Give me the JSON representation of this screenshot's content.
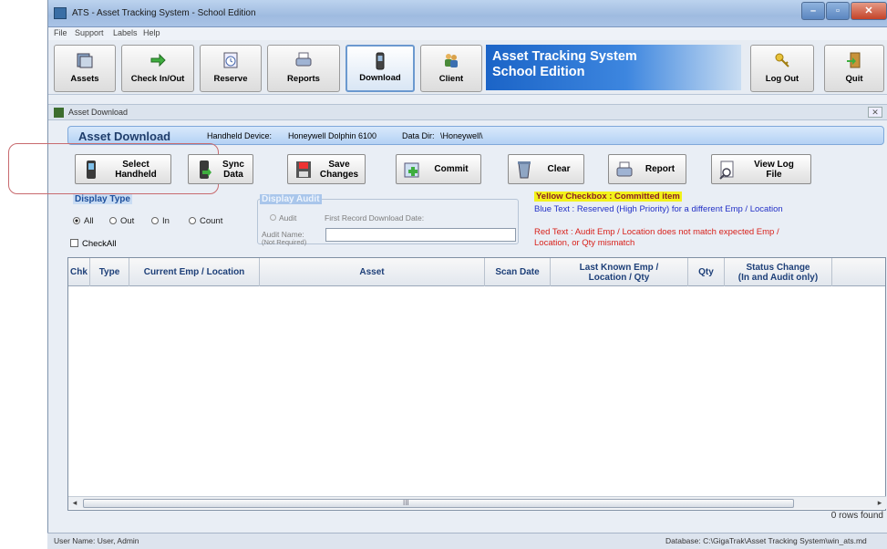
{
  "window": {
    "title": "ATS - Asset Tracking System - School Edition"
  },
  "menu": [
    "File",
    "Support",
    "Labels",
    "Help"
  ],
  "toolbar": {
    "buttons": [
      "Assets",
      "Check In/Out",
      "Reserve",
      "Reports",
      "Download",
      "Client"
    ],
    "banner_line1": "Asset Tracking System",
    "banner_line2": "School Edition",
    "logout": "Log Out",
    "quit": "Quit"
  },
  "child_window": {
    "title": "Asset Download"
  },
  "header": {
    "title": "Asset Download",
    "device_label": "Handheld Device:",
    "device": "Honeywell Dolphin 6100",
    "dir_label": "Data Dir:",
    "dir": "\\Honeywell\\"
  },
  "actions": [
    "Select\nHandheld",
    "Sync\nData",
    "Save\nChanges",
    "Commit",
    "Clear",
    "Report",
    "View Log\nFile"
  ],
  "display_type": {
    "label": "Display Type",
    "options": [
      "All",
      "Out",
      "In",
      "Count"
    ],
    "selected": "All",
    "check_all": "CheckAll"
  },
  "display_audit": {
    "label": "Display Audit",
    "audit_radio": "Audit",
    "first_record": "First Record Download Date:",
    "audit_name": "Audit Name:",
    "not_required": "(Not Required)"
  },
  "legend": {
    "yellow": "Yellow Checkbox :  Committed item",
    "blue": "Blue Text :  Reserved (High Priority) for a different Emp / Location",
    "red": "Red Text :  Audit Emp / Location does not match expected Emp / Location, or Qty mismatch"
  },
  "grid": {
    "columns": [
      "Chk",
      "Type",
      "Current Emp / Location",
      "Asset",
      "Scan Date",
      "Last Known Emp /\nLocation / Qty",
      "Qty",
      "Status Change\n(In and Audit only)"
    ],
    "rows": [],
    "scroll_mark": "III"
  },
  "rows_found": "0 rows found",
  "status": {
    "user": "User Name:  User, Admin",
    "database": "Database:  C:\\GigaTrak\\Asset Tracking System\\win_ats.md"
  },
  "colors": {
    "banner": "#1b64c7",
    "highlight": "#c86a6e",
    "legend_yellow": "#f2f21a"
  }
}
